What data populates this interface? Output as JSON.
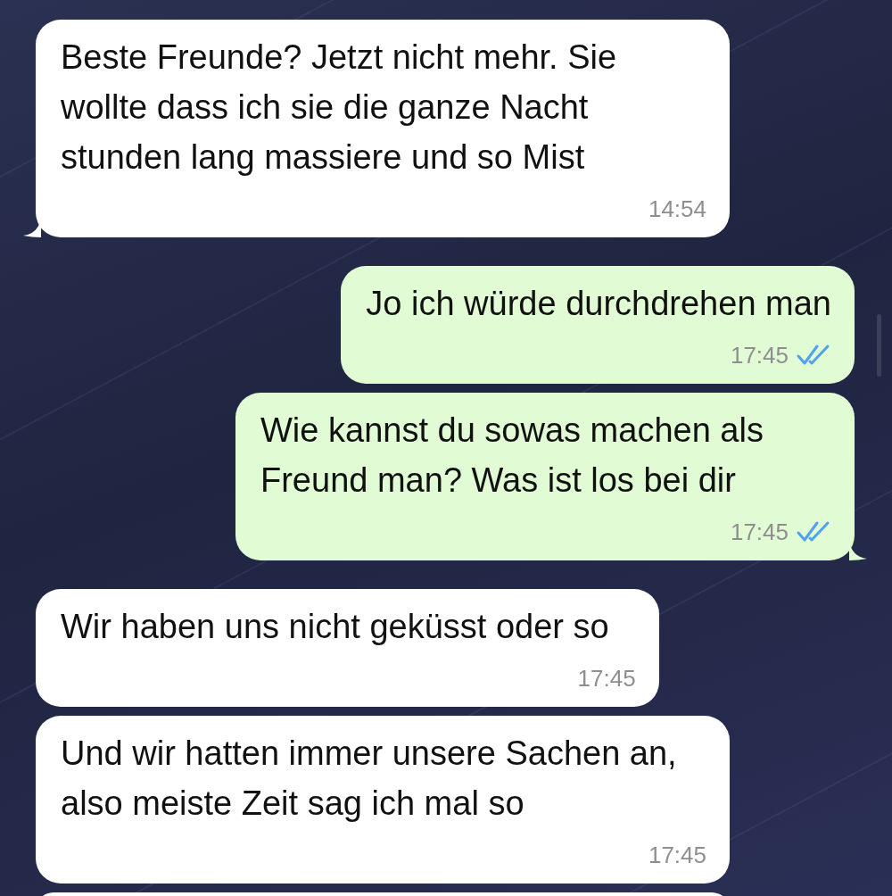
{
  "messages": [
    {
      "kind": "incoming",
      "text": "Beste Freunde? Jetzt nicht mehr. Sie wollte dass ich sie die ganze Nacht stunden lang massiere und so Mist",
      "time": "14:54",
      "tail": true
    },
    {
      "kind": "outgoing",
      "text": "Jo ich würde durchdrehen man",
      "time": "17:45",
      "read": true,
      "tail": false
    },
    {
      "kind": "outgoing",
      "text": "Wie kannst du sowas machen als Freund man? Was ist los bei dir",
      "time": "17:45",
      "read": true,
      "tail": true
    },
    {
      "kind": "incoming",
      "text": "Wir haben uns nicht geküsst oder so",
      "time": "17:45",
      "tail": false
    },
    {
      "kind": "incoming",
      "text": "Und wir hatten immer unsere Sachen an, also meiste Zeit sag ich mal so",
      "time": "17:45",
      "tail": false
    }
  ]
}
